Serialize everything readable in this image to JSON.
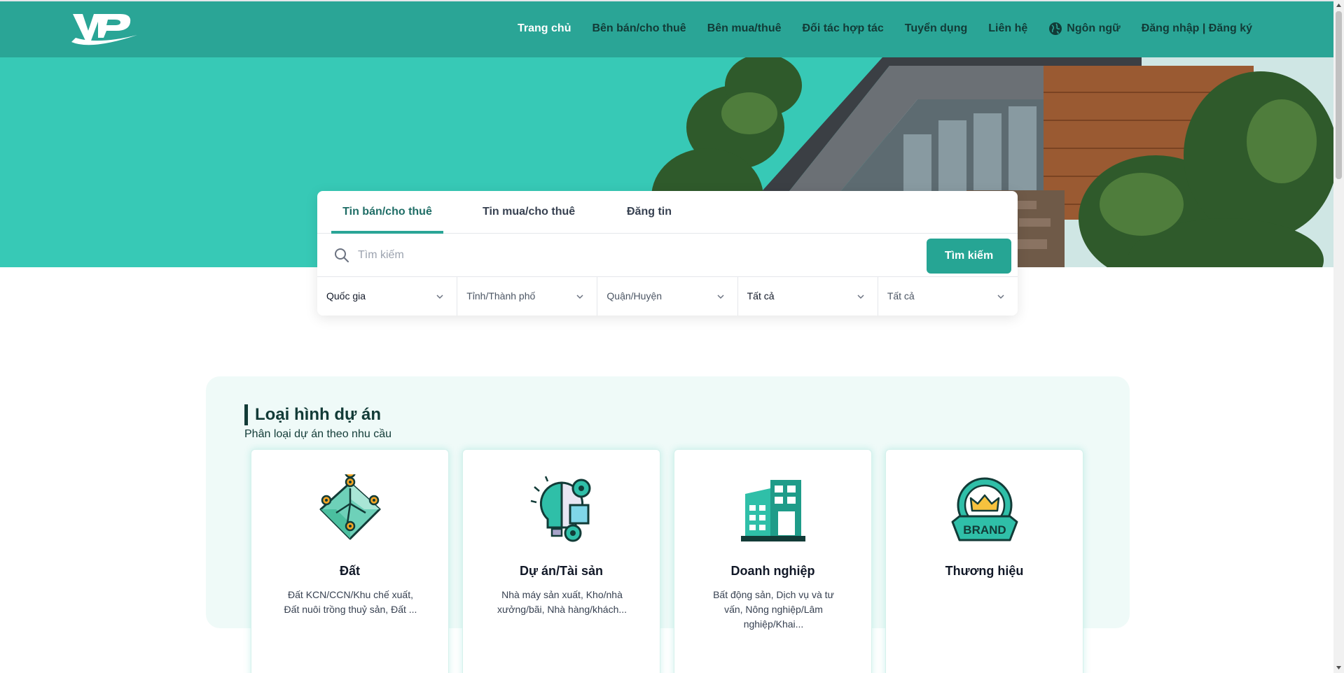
{
  "header": {
    "logo_alt": "VP",
    "nav": [
      {
        "label": "Trang chủ",
        "active": true
      },
      {
        "label": "Bên bán/cho thuê"
      },
      {
        "label": "Bên mua/thuê"
      },
      {
        "label": "Đối tác hợp tác"
      },
      {
        "label": "Tuyển dụng"
      },
      {
        "label": "Liên hệ"
      },
      {
        "label": "Ngôn ngữ",
        "icon": "globe-icon"
      },
      {
        "label": "Đăng nhập | Đăng ký"
      }
    ]
  },
  "search": {
    "tabs": [
      {
        "label": "Tin bán/cho thuê",
        "active": true
      },
      {
        "label": "Tin mua/cho thuê"
      },
      {
        "label": "Đăng tin"
      }
    ],
    "placeholder": "Tìm kiếm",
    "button": "Tìm kiếm",
    "filters": [
      {
        "label": "Quốc gia"
      },
      {
        "label": "Tỉnh/Thành phố"
      },
      {
        "label": "Quận/Huyện"
      },
      {
        "label": "Tất cả"
      },
      {
        "label": "Tất cả"
      }
    ]
  },
  "project_types": {
    "title": "Loại hình dự án",
    "subtitle": "Phân loại dự án theo nhu cầu",
    "cards": [
      {
        "title": "Đất",
        "desc": "Đất KCN/CCN/Khu chế xuất, Đất nuôi trồng thuỷ sản, Đất ...",
        "icon": "land-map-icon"
      },
      {
        "title": "Dự án/Tài sản",
        "desc": "Nhà máy sản xuất, Kho/nhà xưởng/bãi, Nhà hàng/khách...",
        "icon": "project-lightbulb-icon"
      },
      {
        "title": "Doanh nghiệp",
        "desc": "Bất động sản, Dịch vụ và tư vấn, Nông nghiệp/Lâm nghiệp/Khai...",
        "icon": "building-icon"
      },
      {
        "title": "Thương hiệu",
        "desc": "",
        "icon": "brand-badge-icon"
      }
    ],
    "brand_badge_text": "BRAND"
  },
  "colors": {
    "primary": "#2aa596",
    "hero_bg": "#37c9b6",
    "dark_text": "#123b37"
  }
}
